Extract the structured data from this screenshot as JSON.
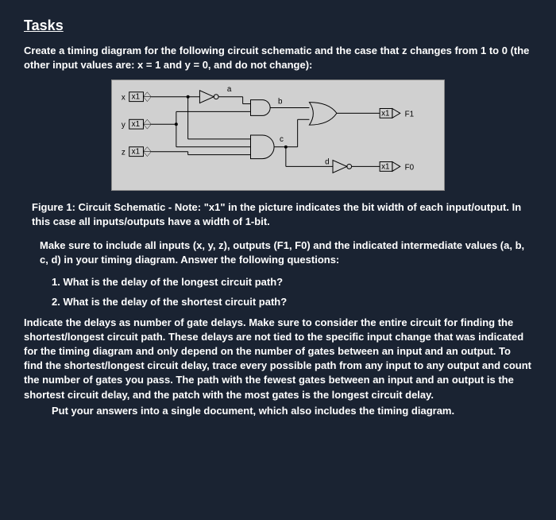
{
  "heading": "Tasks",
  "intro": "Create a timing diagram for the following circuit schematic and the case that z changes from 1 to 0 (the other input values are: x = 1 and y = 0, and do not change):",
  "circuit": {
    "inputs": [
      "x",
      "y",
      "z"
    ],
    "input_bitwidth": "x1",
    "wires": [
      "a",
      "b",
      "c",
      "d"
    ],
    "outputs": [
      {
        "name": "F1",
        "bitwidth": "x1"
      },
      {
        "name": "F0",
        "bitwidth": "x1"
      }
    ]
  },
  "figure_caption": "Figure 1: Circuit Schematic - Note: \"x1\" in the picture indicates the bit width of each input/output. In this case all inputs/outputs have a width of 1-bit.",
  "para1": "Make sure to include all inputs (x, y, z), outputs (F1, F0) and the indicated intermediate values (a, b, c, d) in your timing diagram. Answer the following questions:",
  "questions": [
    "1. What is the delay of the longest circuit path?",
    "2. What is the delay of the shortest circuit path?"
  ],
  "para2": "Indicate the delays as number of gate delays. Make sure to consider the entire circuit for finding the shortest/longest circuit path. These delays are not tied to the specific input change that was indicated for the timing diagram and only depend on the number of gates between an input and an output. To find the shortest/longest circuit delay, trace every possible path from any input to any output and count the number of gates you pass. The path with the fewest gates between an input and an output is the shortest circuit delay, and the patch with the most gates is the longest circuit delay.",
  "final": "Put your answers into a single document, which also includes the timing diagram."
}
